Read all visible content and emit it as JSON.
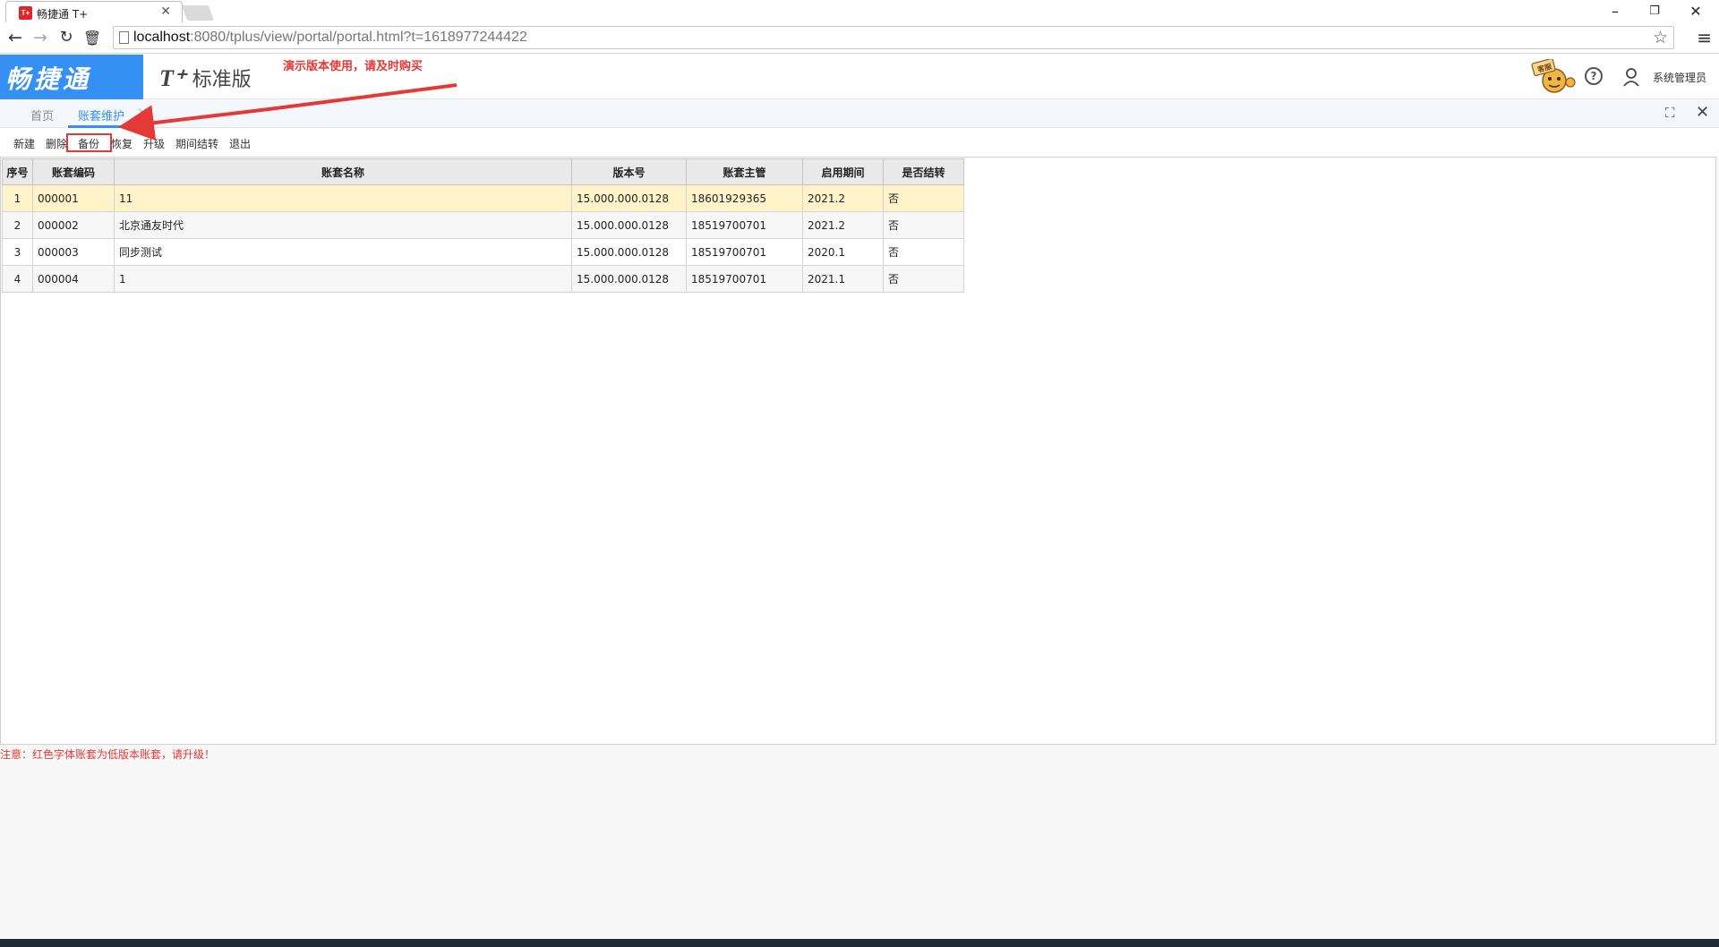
{
  "browser": {
    "tab_title": "畅捷通 T+",
    "favicon_text": "T+",
    "url_host": "localhost",
    "url_rest": ":8080/tplus/view/portal/portal.html?t=1618977244422"
  },
  "header": {
    "brand": "畅捷通",
    "product_prefix": "T⁺",
    "product_name": "标准版",
    "demo_note": "演示版本使用，请及时购买",
    "mascot_label": "客服",
    "user_name": "系统管理员"
  },
  "tabs": [
    {
      "label": "首页"
    },
    {
      "label": "账套维护"
    }
  ],
  "toolbar": {
    "new": "新建",
    "delete": "删除",
    "backup": "备份",
    "restore": "恢复",
    "upgrade": "升级",
    "period_close": "期间结转",
    "exit": "退出"
  },
  "table": {
    "headers": [
      "序号",
      "账套编码",
      "账套名称",
      "版本号",
      "账套主管",
      "启用期间",
      "是否结转"
    ],
    "rows": [
      [
        "1",
        "000001",
        "11",
        "15.000.000.0128",
        "18601929365",
        "2021.2",
        "否"
      ],
      [
        "2",
        "000002",
        "北京通友时代",
        "15.000.000.0128",
        "18519700701",
        "2021.2",
        "否"
      ],
      [
        "3",
        "000003",
        "同步测试",
        "15.000.000.0128",
        "18519700701",
        "2020.1",
        "否"
      ],
      [
        "4",
        "000004",
        "1",
        "15.000.000.0128",
        "18519700701",
        "2021.1",
        "否"
      ]
    ]
  },
  "footnote": "注意：红色字体账套为低版本账套，请升级！",
  "colors": {
    "brand_blue": "#3590f3",
    "highlight_red": "#e53935",
    "selected_row": "#fff4c9"
  }
}
